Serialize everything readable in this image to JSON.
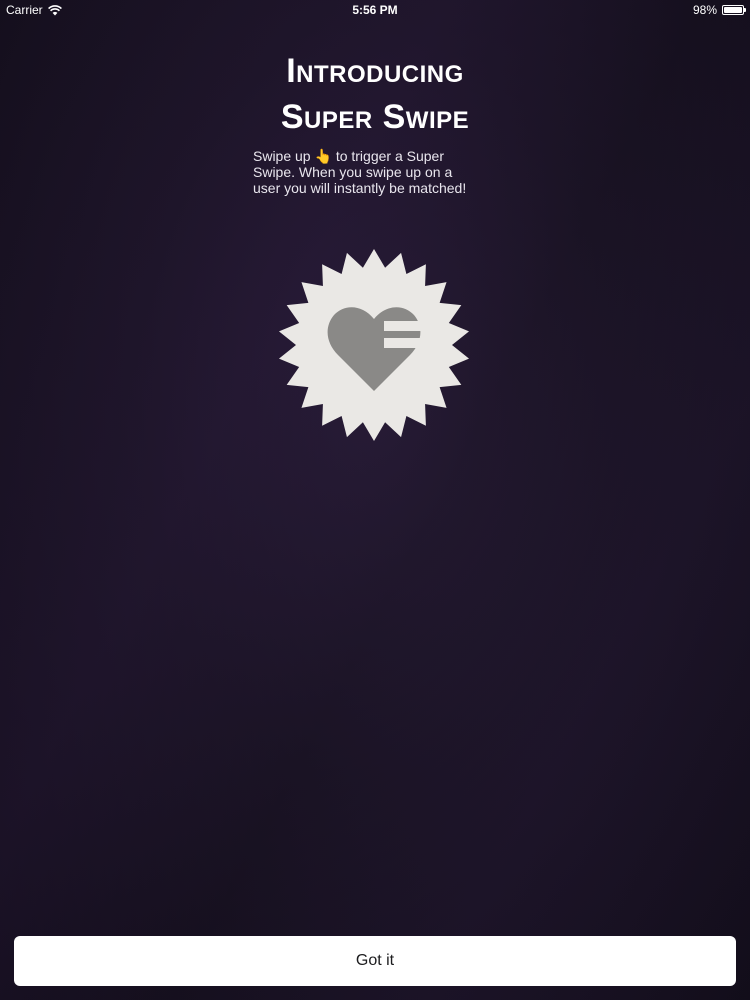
{
  "status_bar": {
    "carrier": "Carrier",
    "time": "5:56 PM",
    "battery_text": "98%",
    "battery_level": 0.98,
    "wifi_icon": "wifi-icon",
    "battery_icon": "battery-icon"
  },
  "intro": {
    "title_line1": "Introducing",
    "title_line2": "Super Swipe",
    "desc_line1_before": "Swipe up",
    "desc_emoji": "👆",
    "desc_line1_after": "to trigger a Super",
    "desc_line2": "Swipe.  When you swipe up on a",
    "desc_line3": "user you will instantly be matched!",
    "badge_icon": "super-swipe-badge-icon"
  },
  "actions": {
    "got_it_label": "Got it"
  },
  "colors": {
    "background_dark": "#120d1a",
    "background_mid": "#251a33",
    "badge_fill": "#eae8e5",
    "heart_fill": "#8a8987",
    "button_bg": "#ffffff",
    "button_text": "#1c1c1e"
  }
}
